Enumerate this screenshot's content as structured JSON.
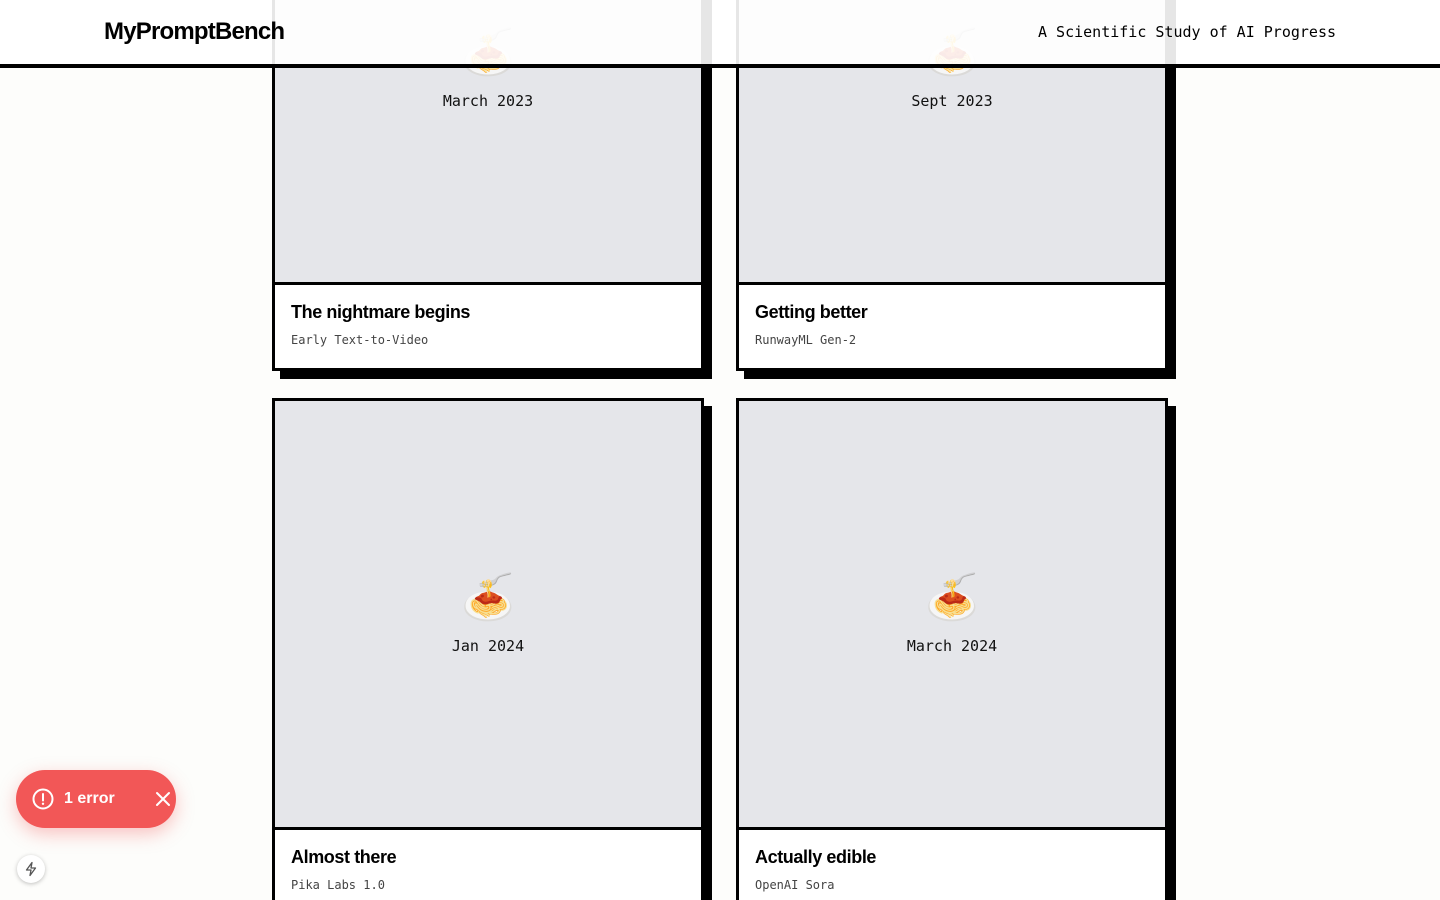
{
  "header": {
    "logo": "MyPromptBench",
    "tagline": "A Scientific Study of AI Progress"
  },
  "cards": [
    {
      "date": "March 2023",
      "title": "The nightmare begins",
      "subtitle": "Early Text-to-Video",
      "emoji": "🍝"
    },
    {
      "date": "Sept 2023",
      "title": "Getting better",
      "subtitle": "RunwayML Gen-2",
      "emoji": "🍝"
    },
    {
      "date": "Jan 2024",
      "title": "Almost there",
      "subtitle": "Pika Labs 1.0",
      "emoji": "🍝"
    },
    {
      "date": "March 2024",
      "title": "Actually edible",
      "subtitle": "OpenAI Sora",
      "emoji": "🍝"
    }
  ],
  "error_toast": {
    "label": "1 error",
    "color": "#f25757"
  },
  "icons": {
    "error": "alert-circle-icon",
    "close": "close-icon",
    "dev_tools": "lightning-bolt-icon"
  }
}
